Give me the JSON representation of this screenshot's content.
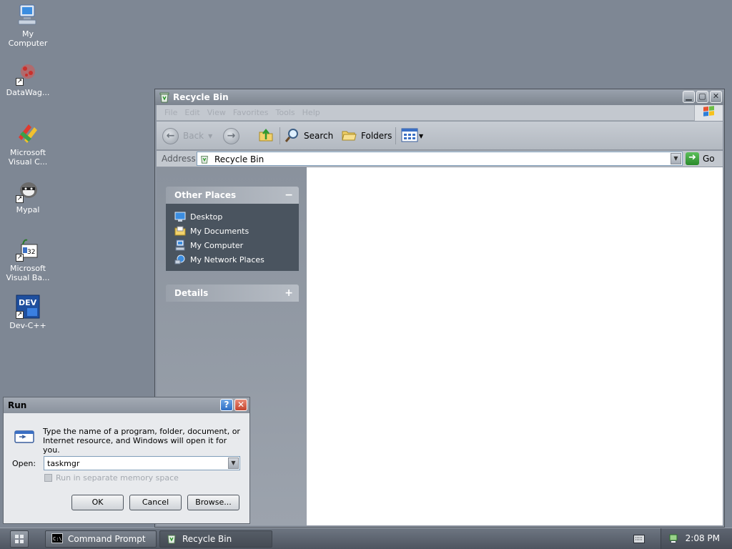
{
  "desktop": {
    "icons": [
      {
        "label": "My Computer",
        "icon": "my-computer-icon"
      },
      {
        "label": "DataWag...",
        "icon": "datawag-icon"
      },
      {
        "label": "Microsoft Visual C...",
        "icon": "visual-c-icon"
      },
      {
        "label": "Mypal",
        "icon": "mypal-icon"
      },
      {
        "label": "Microsoft Visual Ba...",
        "icon": "visual-basic-icon"
      },
      {
        "label": "Dev-C++",
        "icon": "dev-cpp-icon"
      }
    ]
  },
  "explorer": {
    "title": "Recycle Bin",
    "menu": [
      "File",
      "Edit",
      "View",
      "Favorites",
      "Tools",
      "Help"
    ],
    "toolbar": {
      "back": "Back",
      "search": "Search",
      "folders": "Folders"
    },
    "address": {
      "label": "Address",
      "value": "Recycle Bin",
      "go": "Go"
    },
    "task_pane": {
      "other_places": {
        "title": "Other Places",
        "toggle": "−",
        "links": [
          "Desktop",
          "My Documents",
          "My Computer",
          "My Network Places"
        ]
      },
      "details": {
        "title": "Details",
        "toggle": "+"
      }
    }
  },
  "run_dialog": {
    "title": "Run",
    "message": "Type the name of a program, folder, document, or Internet resource, and Windows will open it for you.",
    "open_label": "Open:",
    "open_value": "taskmgr",
    "checkbox_label": "Run in separate memory space",
    "ok": "OK",
    "cancel": "Cancel",
    "browse": "Browse...",
    "help": "?",
    "close": "✕"
  },
  "taskbar": {
    "tasks": [
      {
        "label": "Command Prompt",
        "icon": "command-prompt-icon",
        "active": false
      },
      {
        "label": "Recycle Bin",
        "icon": "recycle-bin-icon",
        "active": true
      }
    ],
    "clock": "2:08 PM"
  },
  "colors": {
    "desktop": "#7e8794",
    "window_frame": "#8e96a2",
    "task_pane_body": "#4a545f",
    "go_green": "#2b8a2b"
  }
}
